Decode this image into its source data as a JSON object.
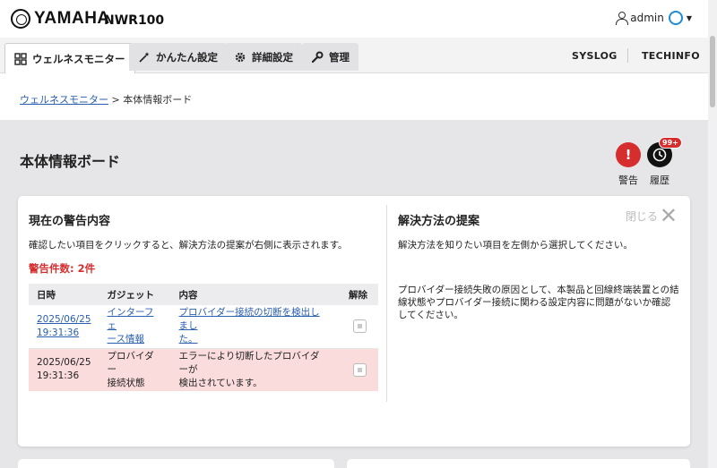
{
  "header": {
    "brand": "YAMAHA",
    "model": "NWR100",
    "user": "admin"
  },
  "tabs": [
    {
      "label": "ウェルネスモニター",
      "icon": "dashboard-icon",
      "active": true
    },
    {
      "label": "かんたん設定",
      "icon": "magic-wand-icon",
      "active": false
    },
    {
      "label": "詳細設定",
      "icon": "gear-icon",
      "active": false
    },
    {
      "label": "管理",
      "icon": "wrench-icon",
      "active": false
    }
  ],
  "right_links": {
    "syslog": "SYSLOG",
    "techinfo": "TECHINFO"
  },
  "breadcrumb": {
    "link": "ウェルネスモニター",
    "separator": " > ",
    "current": "本体情報ボード"
  },
  "page_title": "本体情報ボード",
  "side_actions": {
    "alert_label": "警告",
    "alert_glyph": "!",
    "history_label": "履歴",
    "history_badge": "99+"
  },
  "alerts_panel": {
    "title": "現在の警告内容",
    "instruction": "確認したい項目をクリックすると、解決方法の提案が右側に表示されます。",
    "count_label": "警告件数: 2件",
    "columns": [
      "日時",
      "ガジェット",
      "内容",
      "解除"
    ],
    "rows": [
      {
        "date": "2025/06/25",
        "time": "19:31:36",
        "gadget_1": "インターフェ",
        "gadget_2": "ース情報",
        "content_1": "プロバイダー接続の切断を検出しまし",
        "content_2": "た。"
      },
      {
        "date": "2025/06/25",
        "time": "19:31:36",
        "gadget_1": "プロバイダー",
        "gadget_2": "接続状態",
        "content_1": "エラーにより切断したプロバイダーが",
        "content_2": "検出されています。"
      }
    ]
  },
  "solution_panel": {
    "title": "解決方法の提案",
    "close_label": "閉じる",
    "hint": "解決方法を知りたい項目を左側から選択してください。",
    "detail_1": "プロバイダー接続失敗の原因として、本製品と回線終端装置との結",
    "detail_2": "線状態やプロバイダー接続に関わる設定内容に問題がないか確認",
    "detail_3": "してください。"
  },
  "colors": {
    "alert_red": "#d62e2e",
    "link_blue": "#2a5fb0",
    "row_highlight": "#fbdcdc"
  }
}
